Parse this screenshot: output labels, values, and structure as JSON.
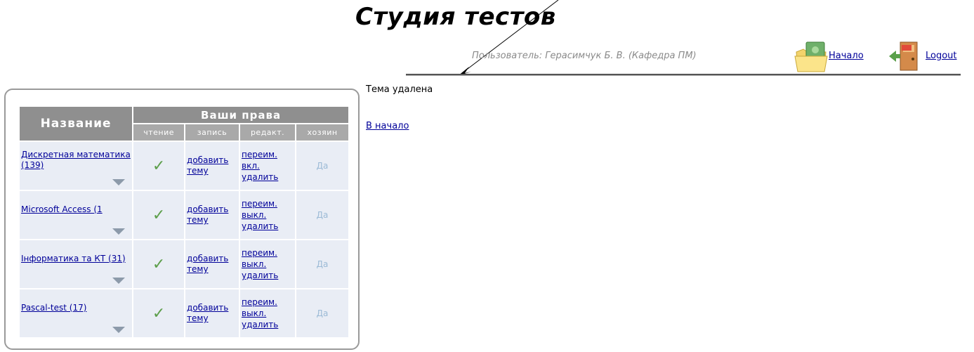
{
  "app": {
    "title": "Студия тестов"
  },
  "userbar": {
    "user_text": "Пользователь: Герасимчук Б. В. (Кафедра ПМ)",
    "home_label": "Начало",
    "logout_label": "Logout"
  },
  "table": {
    "header_name": "Название",
    "header_rights": "Ваши права",
    "sub_headers": [
      "чтение",
      "запись",
      "редакт.",
      "хозяин"
    ],
    "rows": [
      {
        "name": "Дискретная математика (139)",
        "read": "✓",
        "write": "добавить тему",
        "edit": [
          "переим.",
          "вкл.",
          "удалить"
        ],
        "owner": "Да"
      },
      {
        "name": "Microsoft Access (1",
        "read": "✓",
        "write": "добавить тему",
        "edit": [
          "переим.",
          "выкл.",
          "удалить"
        ],
        "owner": "Да"
      },
      {
        "name": "Інформатика та КТ (31)",
        "read": "✓",
        "write": "добавить тему",
        "edit": [
          "переим.",
          "выкл.",
          "удалить"
        ],
        "owner": "Да"
      },
      {
        "name": "Pascal-test (17)",
        "read": "✓",
        "write": "добавить тему",
        "edit": [
          "переим.",
          "выкл.",
          "удалить"
        ],
        "owner": "Да"
      }
    ]
  },
  "main": {
    "status_text": "Тема удалена",
    "back_link": "В начало"
  },
  "icons": {
    "home": "folder-home-icon",
    "logout": "door-exit-icon",
    "expand": "dropdown-triangle-icon"
  },
  "colors": {
    "header_bg": "#8f8f8f",
    "subheader_bg": "#a9a9a9",
    "row_bg": "#e9edf5",
    "link": "#000099",
    "check": "#5c9e4a"
  }
}
